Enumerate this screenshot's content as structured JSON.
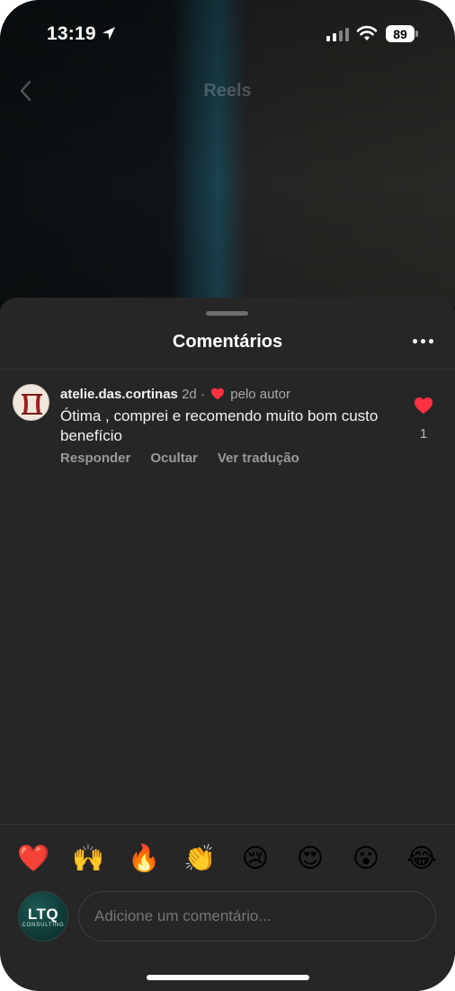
{
  "status": {
    "time": "13:19",
    "battery": "89"
  },
  "header": {
    "title": "Reels"
  },
  "sheet": {
    "title": "Comentários",
    "comment": {
      "username": "atelie.das.cortinas",
      "age": "2d",
      "separator": "·",
      "liked_by_author": "pelo autor",
      "text": "Ótima , comprei e recomendo muito bom custo benefício",
      "actions": [
        "Responder",
        "Ocultar",
        "Ver tradução"
      ],
      "like_count": "1"
    },
    "reactions": [
      "❤️",
      "🙌",
      "🔥",
      "👏",
      "😢",
      "😍",
      "😮",
      "😂"
    ],
    "profile_avatar": {
      "text": "LTQ",
      "subtext": "CONSULTING"
    },
    "input": {
      "placeholder": "Adicione um comentário..."
    }
  },
  "colors": {
    "sheet_bg": "#262626",
    "like_red": "#ff3040"
  },
  "icons": [
    "location-arrow-icon",
    "cellular-signal-icon",
    "wifi-icon",
    "battery-icon",
    "back-chevron-icon",
    "more-horizontal-icon",
    "heart-icon"
  ]
}
